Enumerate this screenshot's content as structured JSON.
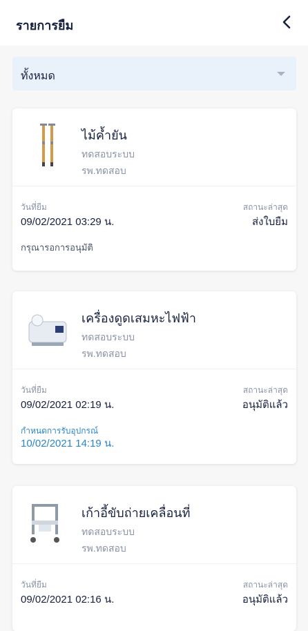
{
  "header": {
    "title": "รายการยืม"
  },
  "filter": {
    "selected": "ทั้งหมด"
  },
  "cards": [
    {
      "name": "ไม้ค้ำยัน",
      "sub1": "ทดสอบระบบ",
      "sub2": "รพ.ทดสอบ",
      "borrow_label": "วันที่ยืม",
      "borrow_date": "09/02/2021 03:29 น.",
      "status_label": "สถานะล่าสุด",
      "status_value": "ส่งใบยืม",
      "note": "กรุณารอการอนุมัติ"
    },
    {
      "name": "เครื่องดูดเสมหะไฟฟ้า",
      "sub1": "ทดสอบระบบ",
      "sub2": "รพ.ทดสอบ",
      "borrow_label": "วันที่ยืม",
      "borrow_date": "09/02/2021 02:19 น.",
      "status_label": "สถานะล่าสุด",
      "status_value": "อนุมัติแล้ว",
      "pickup_label": "กำหนดการรับอุปกรณ์",
      "pickup_value": "10/02/2021 14:19 น."
    },
    {
      "name": "เก้าอี้ขับถ่ายเคลื่อนที่",
      "sub1": "ทดสอบระบบ",
      "sub2": "รพ.ทดสอบ",
      "borrow_label": "วันที่ยืม",
      "borrow_date": "09/02/2021 02:16 น.",
      "status_label": "สถานะล่าสุด",
      "status_value": "อนุมัติแล้ว"
    }
  ]
}
